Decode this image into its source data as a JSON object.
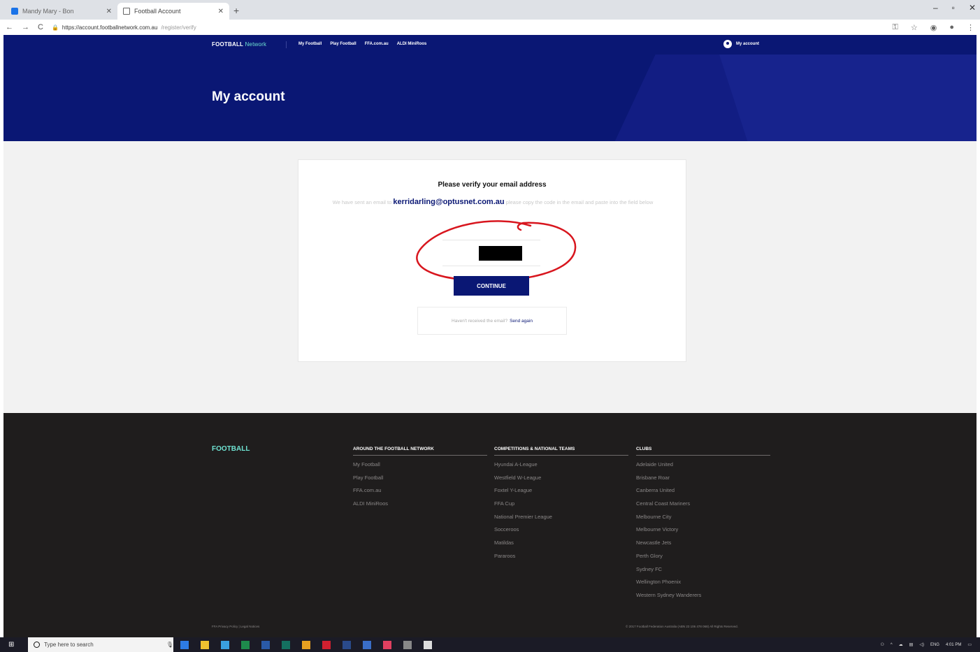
{
  "browser": {
    "tabs": [
      {
        "title": "Mandy Mary - Bon"
      },
      {
        "title": "Football Account"
      }
    ],
    "url_main": "https://account.footballnetwork.com.au",
    "url_rest": "/register/verify"
  },
  "nav": {
    "brand": "FOOTBALL",
    "brand_suffix": "Network",
    "links": [
      "My Football",
      "Play Football",
      "FFA.com.au",
      "ALDI MiniRoos"
    ],
    "account": "My account"
  },
  "hero": {
    "title": "My account"
  },
  "verify": {
    "heading": "Please verify your email address",
    "msg_pre": "We have sent an email to ",
    "email": "kerridarling@optusnet.com.au",
    "msg_post": " please copy the code in the email and paste into the field below",
    "continue": "CONTINUE",
    "resend_q": "Haven't received the email?",
    "resend_link": "Send again"
  },
  "footer": {
    "logo": "FOOTBALL",
    "columns": [
      {
        "heading": "AROUND THE FOOTBALL NETWORK",
        "items": [
          "My Football",
          "Play Football",
          "FFA.com.au",
          "ALDI MiniRoos"
        ]
      },
      {
        "heading": "COMPETITIONS & NATIONAL TEAMS",
        "items": [
          "Hyundai A-League",
          "Westfield W-League",
          "Foxtel Y-League",
          "FFA Cup",
          "National Premier League",
          "Socceroos",
          "Matildas",
          "Pararoos"
        ]
      },
      {
        "heading": "CLUBS",
        "items": [
          "Adelaide United",
          "Brisbane Roar",
          "Canberra United",
          "Central Coast Mariners",
          "Melbourne City",
          "Melbourne Victory",
          "Newcastle Jets",
          "Perth Glory",
          "Sydney FC",
          "Wellington Phoenix",
          "Western Sydney Wanderers"
        ]
      }
    ],
    "bottom_left": "FFA Privacy Policy | Legal Notices",
    "bottom_right": "© 2017 Football Federation Australia (ABN 23 106 478 068) All Rights Reserved."
  },
  "taskbar": {
    "search_placeholder": "Type here to search",
    "lang": "ENG",
    "time": "4:01 PM"
  },
  "colors": {
    "navy": "#0a1774",
    "footer_bg": "#1f1d1d",
    "teal": "#6fe3d2",
    "annotation_red": "#d8161e"
  }
}
